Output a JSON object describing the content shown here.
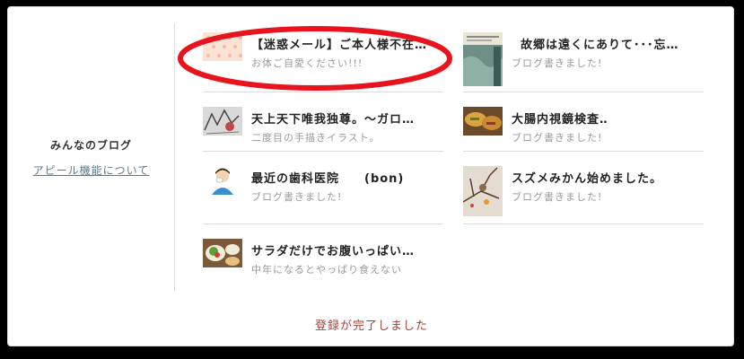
{
  "sidebar": {
    "title": "みんなのブログ",
    "link": "アピール機能について"
  },
  "posts": [
    {
      "title": "【迷惑メール】ご本人様不在…",
      "sub": "お体ご自愛ください!!!",
      "icon": "pink-dot-pattern-thumbnail"
    },
    {
      "title": "故郷は遠くにありて･･･忘…",
      "sub": "ブログ書きました!",
      "icon": "book-cover-thumbnail"
    },
    {
      "title": "天上天下唯我独尊。〜ガロ…",
      "sub": "二度目の手描きイラスト。",
      "icon": "sketch-thumbnail"
    },
    {
      "title": "大腸内視鏡検査‥",
      "sub": "ブログ書きました!",
      "icon": "food-thumbnail"
    },
    {
      "title": "最近の歯科医院　　(bon)",
      "sub": "ブログ書きました!",
      "icon": "dentist-person-icon"
    },
    {
      "title": "スズメみかん始めました。",
      "sub": "ブログ書きました!",
      "icon": "sparrow-branch-thumbnail"
    },
    {
      "title": "サラダだけでお腹いっぱい…",
      "sub": "中年になるとやっぱり食えない",
      "icon": "salad-meal-thumbnail"
    }
  ],
  "status": "登録が完了しました",
  "colors": {
    "highlight_oval": "#e8141d",
    "status_text": "#a0423a",
    "link": "#5a7a8a"
  }
}
